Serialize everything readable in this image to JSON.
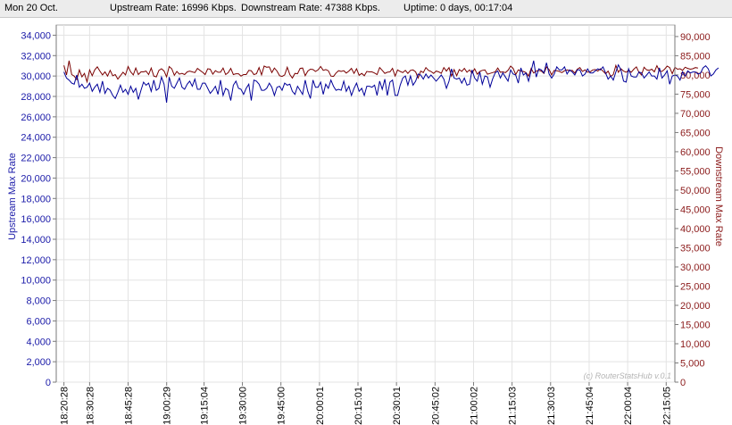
{
  "status_bar": {
    "date": "Mon 20 Oct.",
    "upstream_rate": "Upstream Rate: 16996 Kbps.",
    "downstream_rate": "Downstream Rate: 47388 Kbps.",
    "uptime": "Uptime: 0 days, 00:17:04"
  },
  "chart_data": {
    "type": "line",
    "watermark": "(c) RouterStatsHub v.0.1",
    "x_tick_labels": [
      "18:20:28",
      "18:30:28",
      "18:45:28",
      "19:00:29",
      "19:15:04",
      "19:30:00",
      "19:45:00",
      "20:00:01",
      "20:15:01",
      "20:30:01",
      "20:45:02",
      "21:00:02",
      "21:15:03",
      "21:30:03",
      "21:45:04",
      "22:00:04",
      "22:15:05"
    ],
    "x_tick_minutes": [
      0,
      10,
      25,
      40.02,
      54.6,
      69.53,
      84.53,
      99.55,
      114.55,
      129.55,
      144.57,
      159.57,
      174.58,
      189.58,
      204.6,
      219.6,
      234.62
    ],
    "x_range_minutes": [
      -3,
      238
    ],
    "grid": true,
    "y_left": {
      "label": "Upstream Max Rate",
      "color": "#1a1aa8",
      "min": 0,
      "max": 35000,
      "step": 2000,
      "tick_labels": [
        "0",
        "2,000",
        "4,000",
        "6,000",
        "8,000",
        "10,000",
        "12,000",
        "14,000",
        "16,000",
        "18,000",
        "20,000",
        "22,000",
        "24,000",
        "26,000",
        "28,000",
        "30,000",
        "32,000",
        "34,000"
      ]
    },
    "y_right": {
      "label": "Downstream Max Rate",
      "color": "#8b1a1a",
      "min": 0,
      "max": 93000,
      "step": 5000,
      "tick_labels": [
        "0",
        "5,000",
        "10,000",
        "15,000",
        "20,000",
        "25,000",
        "30,000",
        "35,000",
        "40,000",
        "45,000",
        "50,000",
        "55,000",
        "60,000",
        "65,000",
        "70,000",
        "75,000",
        "80,000",
        "85,000",
        "90,000"
      ]
    },
    "series": [
      {
        "name": "Upstream Max Rate",
        "axis": "left",
        "color": "#000099",
        "sample_interval_minutes": 1,
        "values": [
          30400,
          29800,
          29600,
          29300,
          29200,
          30100,
          28900,
          29200,
          28800,
          28900,
          29300,
          28500,
          28900,
          29200,
          28400,
          29500,
          28300,
          28800,
          28600,
          28100,
          27800,
          28400,
          29100,
          28400,
          28700,
          28200,
          29000,
          28400,
          28800,
          27700,
          28600,
          29400,
          29100,
          29300,
          28500,
          29600,
          28600,
          28800,
          29900,
          29200,
          27400,
          29900,
          29000,
          28800,
          29300,
          29800,
          28900,
          28700,
          29200,
          29500,
          29000,
          29700,
          28700,
          28700,
          29300,
          29300,
          28800,
          28300,
          28600,
          29000,
          28200,
          29600,
          28100,
          28800,
          28600,
          27600,
          29100,
          29500,
          28800,
          28700,
          28200,
          28800,
          29200,
          27600,
          29600,
          29500,
          29200,
          28600,
          28600,
          28800,
          29300,
          28900,
          28100,
          28900,
          29000,
          28600,
          29300,
          29100,
          29200,
          28500,
          28200,
          29000,
          28600,
          28200,
          29600,
          28500,
          27800,
          29600,
          28900,
          28900,
          29400,
          28200,
          29200,
          28800,
          29600,
          29000,
          28600,
          28700,
          28600,
          29500,
          28500,
          29000,
          28100,
          28800,
          29300,
          28500,
          28800,
          28100,
          29000,
          29000,
          28900,
          29100,
          28100,
          29500,
          28700,
          29700,
          28100,
          29400,
          29600,
          28100,
          28100,
          29100,
          29800,
          30000,
          29100,
          30000,
          29100,
          29500,
          30200,
          30100,
          29700,
          30200,
          29800,
          30100,
          29800,
          29500,
          29800,
          30100,
          29700,
          28800,
          29500,
          30700,
          29800,
          29700,
          29800,
          29300,
          29800,
          29100,
          29200,
          30600,
          29800,
          29500,
          30400,
          29200,
          30000,
          29900,
          28900,
          29700,
          30300,
          30500,
          29800,
          30300,
          29900,
          29500,
          30600,
          30200,
          30100,
          29300,
          30800,
          30100,
          30300,
          29500,
          30500,
          31500,
          29900,
          30700,
          30600,
          30300,
          31300,
          30200,
          29800,
          30200,
          30900,
          30600,
          30600,
          30900,
          30200,
          30600,
          30400,
          30100,
          30600,
          30600,
          30000,
          30200,
          30700,
          30300,
          30300,
          30500,
          30700,
          30600,
          30900,
          30300,
          29700,
          30000,
          29600,
          30400,
          31100,
          30600,
          29500,
          29400,
          30700,
          30000,
          29900,
          29900,
          30400,
          30300,
          29800,
          30100,
          30400,
          30000,
          30000,
          29700,
          30800,
          29800,
          30100,
          30500,
          29200,
          30000,
          30100,
          30000,
          29600,
          30400,
          30000,
          30500,
          30300,
          30400,
          30400,
          30200,
          30300,
          30800,
          31000,
          30700,
          30000,
          30200,
          30600,
          30800
        ]
      },
      {
        "name": "Downstream Max Rate",
        "axis": "right",
        "color": "#7a0000",
        "sample_interval_minutes": 1,
        "values": [
          82500,
          80000,
          83700,
          80100,
          79700,
          78800,
          81300,
          79500,
          80400,
          78200,
          81300,
          79800,
          81300,
          82100,
          81000,
          80000,
          80800,
          79700,
          81200,
          79800,
          80100,
          78900,
          79800,
          80700,
          80000,
          82200,
          80800,
          80000,
          81800,
          80100,
          80800,
          80800,
          81000,
          80100,
          81800,
          79700,
          79500,
          81200,
          81600,
          81000,
          79500,
          82200,
          81600,
          79900,
          80900,
          80200,
          80400,
          80100,
          80800,
          81000,
          80800,
          80600,
          81700,
          81200,
          80700,
          80100,
          81600,
          81500,
          80200,
          81100,
          80700,
          80700,
          81800,
          80100,
          80600,
          81700,
          80100,
          80300,
          80300,
          79700,
          80100,
          80100,
          81200,
          81100,
          80100,
          80300,
          81900,
          80000,
          82300,
          82000,
          82100,
          80600,
          81800,
          81000,
          79800,
          79600,
          80000,
          82000,
          80100,
          79200,
          80400,
          80300,
          81700,
          81800,
          79800,
          81000,
          81500,
          81400,
          80900,
          81300,
          82200,
          81200,
          81400,
          81100,
          79700,
          79600,
          80500,
          81100,
          80900,
          81100,
          80500,
          81000,
          81700,
          80400,
          81600,
          79900,
          80400,
          79800,
          80900,
          80800,
          80800,
          80500,
          80100,
          81900,
          81200,
          80400,
          80700,
          80800,
          81700,
          79700,
          81300,
          80900,
          80600,
          81200,
          80400,
          81200,
          81300,
          80800,
          79200,
          81000,
          80600,
          81900,
          81200,
          80900,
          80400,
          81000,
          80800,
          80400,
          81900,
          81000,
          81900,
          79700,
          81400,
          79800,
          81400,
          80900,
          81700,
          80700,
          81300,
          80500,
          81600,
          80200,
          80900,
          81200,
          81300,
          80200,
          80400,
          80600,
          80800,
          81800,
          80700,
          80800,
          80600,
          81200,
          82300,
          81700,
          80100,
          81300,
          81000,
          80900,
          80600,
          79700,
          81700,
          80500,
          81000,
          81200,
          81000,
          80400,
          82100,
          81400,
          80000,
          81200,
          81100,
          80900,
          80600,
          81100,
          81300,
          81100,
          81200,
          80500,
          81500,
          81900,
          80900,
          81300,
          80700,
          80800,
          81300,
          81400,
          81000,
          81600,
          81000,
          80300,
          81000,
          79600,
          80100,
          82500,
          80700,
          81600,
          81000,
          80700,
          81200,
          80700,
          81500,
          82100,
          80700,
          80000,
          82000,
          81300,
          81200,
          81500,
          80800,
          82400,
          81000,
          80900,
          81500,
          82300,
          81900,
          80300,
          82000,
          81500,
          81600,
          81200,
          82000,
          81700,
          81500,
          81600,
          81900,
          81800
        ]
      }
    ]
  }
}
